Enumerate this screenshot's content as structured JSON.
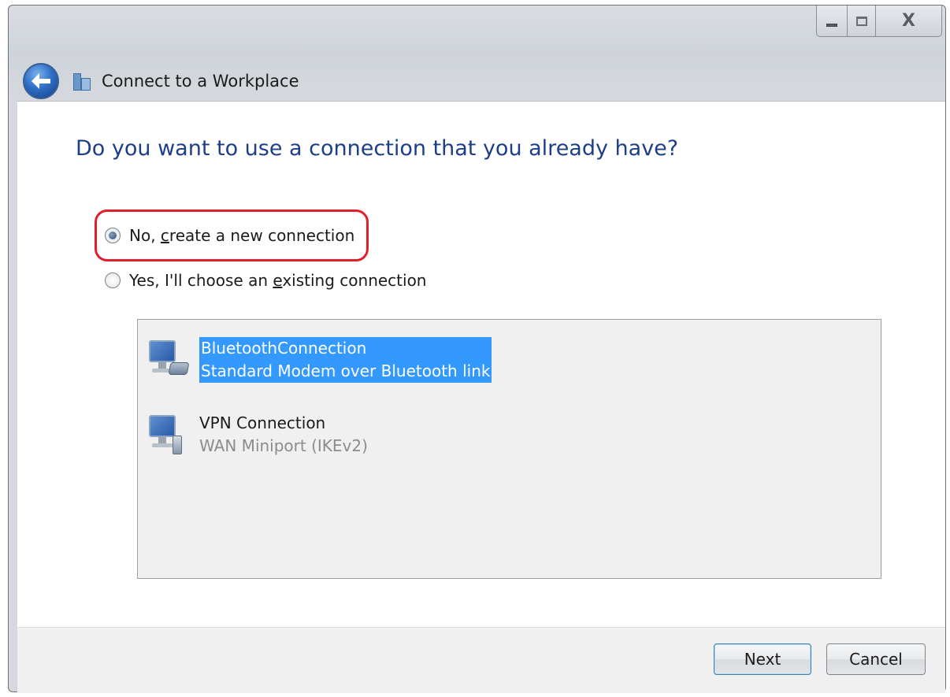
{
  "window": {
    "title": "Connect to a Workplace",
    "caption_buttons": {
      "close_glyph": "X"
    }
  },
  "page": {
    "heading": "Do you want to use a connection that you already have?"
  },
  "options": [
    {
      "label_pre": "No, ",
      "label_ul": "c",
      "label_post": "reate a new connection",
      "selected": true
    },
    {
      "label_pre": "Yes, I'll choose an ",
      "label_ul": "e",
      "label_post": "xisting connection",
      "selected": false
    }
  ],
  "connections": [
    {
      "name": "BluetoothConnection",
      "device": "Standard Modem over Bluetooth link",
      "icon": "modem-network-icon",
      "selected": true
    },
    {
      "name": "VPN Connection",
      "device": "WAN Miniport (IKEv2)",
      "icon": "vpn-network-icon",
      "selected": false
    }
  ],
  "buttons": {
    "next": "Next",
    "cancel": "Cancel"
  },
  "colors": {
    "heading": "#1d3f88",
    "selection": "#3399ff",
    "highlight_ring": "#e0202a"
  }
}
